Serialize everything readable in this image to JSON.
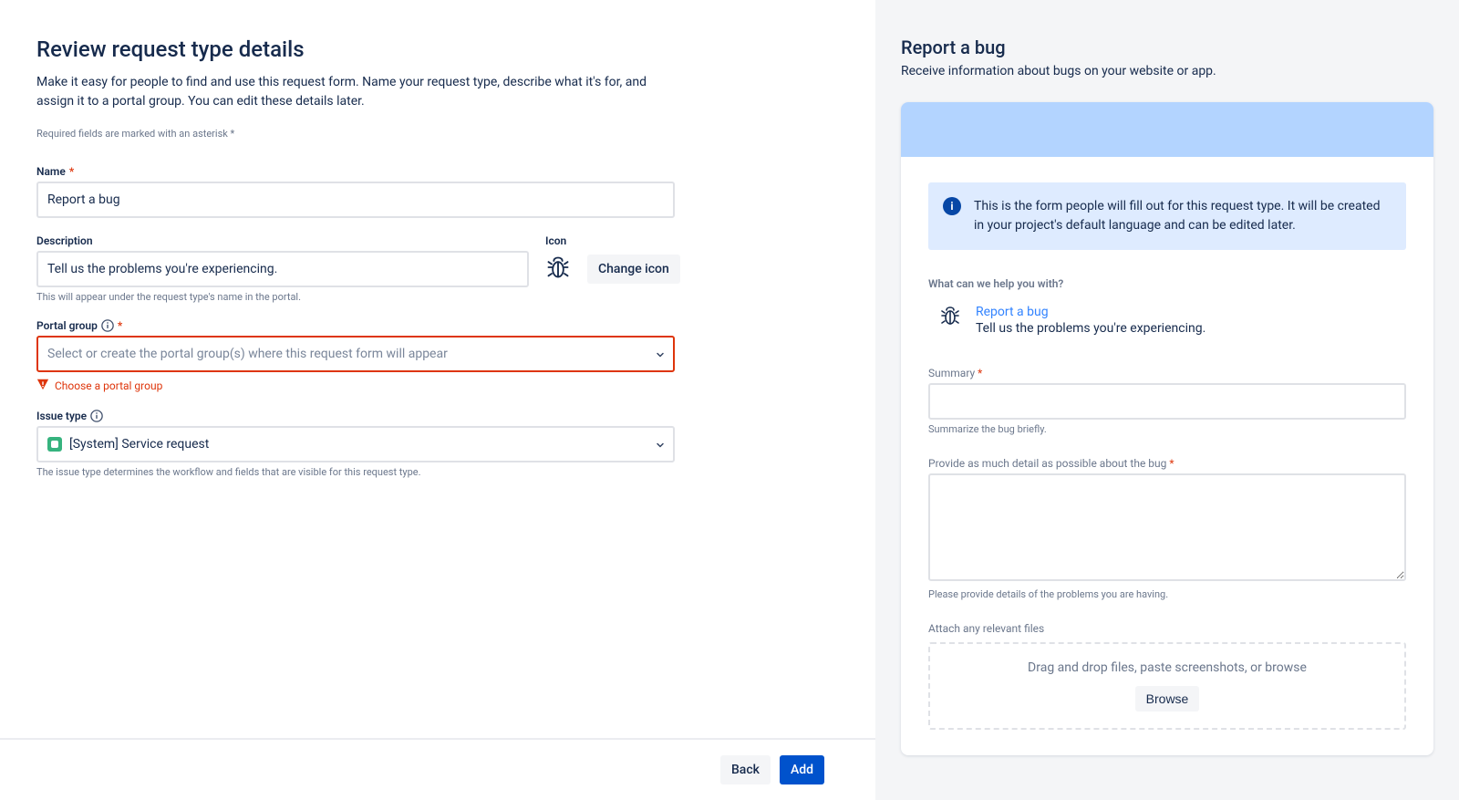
{
  "header": {
    "title": "Review request type details",
    "subtitle": "Make it easy for people to find and use this request form. Name your request type, describe what it's for, and assign it to a portal group. You can edit these details later.",
    "required_note": "Required fields are marked with an asterisk *"
  },
  "form": {
    "name_label": "Name",
    "name_value": "Report a bug",
    "description_label": "Description",
    "description_value": "Tell us the problems you're experiencing.",
    "description_help": "This will appear under the request type's name in the portal.",
    "icon_label": "Icon",
    "change_icon_label": "Change icon",
    "icon_name": "bug-icon",
    "portal_label": "Portal group",
    "portal_placeholder": "Select or create the portal group(s) where this request form will appear",
    "portal_error": "Choose a portal group",
    "issue_label": "Issue type",
    "issue_value": "[System] Service request",
    "issue_help": "The issue type determines the workflow and fields that are visible for this request type."
  },
  "footer": {
    "back_label": "Back",
    "add_label": "Add"
  },
  "preview": {
    "title": "Report a bug",
    "subtitle": "Receive information about bugs on your website or app.",
    "info_text": "This is the form people will fill out for this request type. It will be created in your project's default language and can be edited later.",
    "prompt": "What can we help you with?",
    "request_type_name": "Report a bug",
    "request_type_desc": "Tell us the problems you're experiencing.",
    "summary_label": "Summary",
    "summary_help": "Summarize the bug briefly.",
    "detail_label": "Provide as much detail as possible about the bug",
    "detail_help": "Please provide details of the problems you are having.",
    "attach_label": "Attach any relevant files",
    "dropzone_text": "Drag and drop files, paste screenshots, or browse",
    "browse_label": "Browse"
  }
}
